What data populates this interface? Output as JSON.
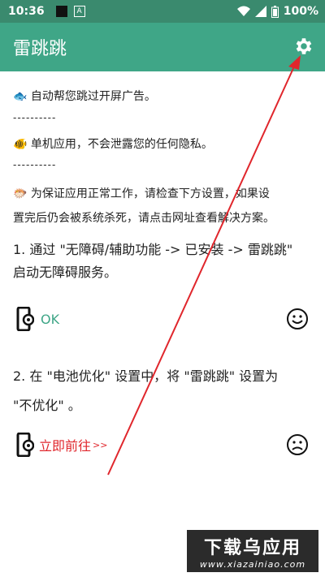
{
  "status": {
    "time": "10:36",
    "badge": "A",
    "battery": "100%"
  },
  "app": {
    "title": "雷跳跳",
    "settings_icon": "gear-icon"
  },
  "info": {
    "line1": "🐟 自动帮您跳过开屏广告。",
    "sep1": "----------",
    "line2": "🐠 单机应用，不会泄露您的任何隐私。",
    "sep2": "----------",
    "line3a": "🐡 为保证应用正常工作，请检查下方设置，如果设",
    "line3b": "置完后仍会被系统杀死，请点击网址查看解决方案。"
  },
  "step1": {
    "line1": "1. 通过 \"无障碍/辅助功能 -> 已安装 -> 雷跳跳\"",
    "line2": "启动无障碍服务。",
    "status": "OK",
    "face": "smile-icon"
  },
  "step2": {
    "line1": "2. 在 \"电池优化\" 设置中，将 \"雷跳跳\" 设置为",
    "line2": "\"不优化\" 。",
    "action": "立即前往",
    "action_arrow": ">>",
    "face": "frown-icon"
  },
  "watermark": {
    "main": "下载乌应用",
    "sub": "www.xiazainiao.com"
  },
  "colors": {
    "primary": "#3fa687",
    "status_bar": "#3a8a6e",
    "arrow": "#e0262c",
    "ok": "#3fa687"
  }
}
